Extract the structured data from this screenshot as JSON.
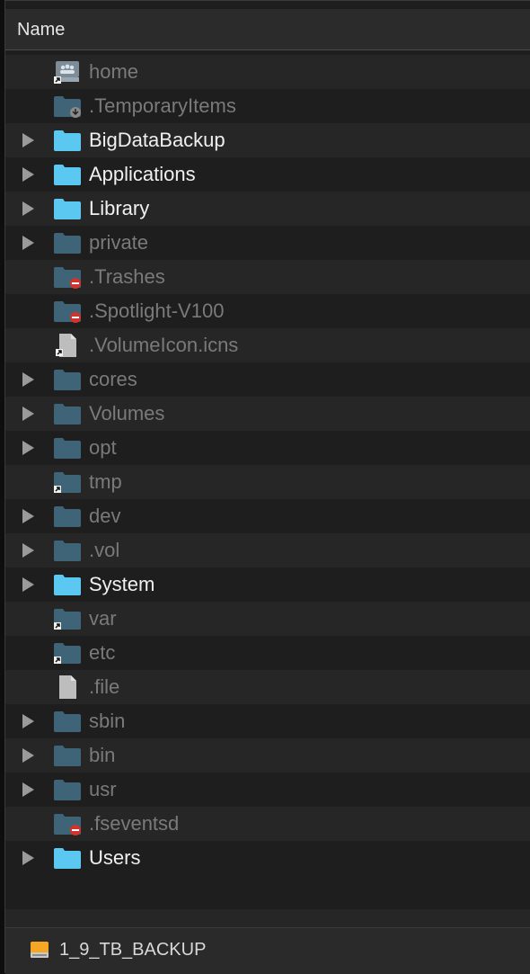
{
  "header": {
    "name_column": "Name"
  },
  "items": [
    {
      "label": "home",
      "icon": "network-user-icon",
      "expandable": false,
      "dim": true
    },
    {
      "label": ".TemporaryItems",
      "icon": "folder-download-badge-icon",
      "expandable": false,
      "dim": true
    },
    {
      "label": "BigDataBackup",
      "icon": "folder-icon",
      "expandable": true,
      "dim": false
    },
    {
      "label": "Applications",
      "icon": "folder-icon",
      "expandable": true,
      "dim": false
    },
    {
      "label": "Library",
      "icon": "folder-icon",
      "expandable": true,
      "dim": false
    },
    {
      "label": "private",
      "icon": "folder-icon",
      "expandable": true,
      "dim": true
    },
    {
      "label": ".Trashes",
      "icon": "folder-restricted-icon",
      "expandable": false,
      "dim": true
    },
    {
      "label": ".Spotlight-V100",
      "icon": "folder-restricted-icon",
      "expandable": false,
      "dim": true
    },
    {
      "label": ".VolumeIcon.icns",
      "icon": "file-alias-icon",
      "expandable": false,
      "dim": true
    },
    {
      "label": "cores",
      "icon": "folder-icon",
      "expandable": true,
      "dim": true
    },
    {
      "label": "Volumes",
      "icon": "folder-icon",
      "expandable": true,
      "dim": true
    },
    {
      "label": "opt",
      "icon": "folder-icon",
      "expandable": true,
      "dim": true
    },
    {
      "label": "tmp",
      "icon": "folder-alias-icon",
      "expandable": false,
      "dim": true
    },
    {
      "label": "dev",
      "icon": "folder-icon",
      "expandable": true,
      "dim": true
    },
    {
      "label": ".vol",
      "icon": "folder-icon",
      "expandable": true,
      "dim": true
    },
    {
      "label": "System",
      "icon": "folder-icon",
      "expandable": true,
      "dim": false
    },
    {
      "label": "var",
      "icon": "folder-alias-icon",
      "expandable": false,
      "dim": true
    },
    {
      "label": "etc",
      "icon": "folder-alias-icon",
      "expandable": false,
      "dim": true
    },
    {
      "label": ".file",
      "icon": "file-icon",
      "expandable": false,
      "dim": true
    },
    {
      "label": "sbin",
      "icon": "folder-icon",
      "expandable": true,
      "dim": true
    },
    {
      "label": "bin",
      "icon": "folder-icon",
      "expandable": true,
      "dim": true
    },
    {
      "label": "usr",
      "icon": "folder-icon",
      "expandable": true,
      "dim": true
    },
    {
      "label": ".fseventsd",
      "icon": "folder-restricted-icon",
      "expandable": false,
      "dim": true
    },
    {
      "label": "Users",
      "icon": "folder-icon",
      "expandable": true,
      "dim": false
    }
  ],
  "footer": {
    "volume_name": "1_9_TB_BACKUP",
    "volume_icon": "external-drive-icon"
  },
  "colors": {
    "folder_bright": "#5ac8f0",
    "folder_dim": "#3f6478",
    "text_bright": "#f0f0f0",
    "text_dim": "#7a7a7a",
    "badge_red": "#d0342c"
  }
}
